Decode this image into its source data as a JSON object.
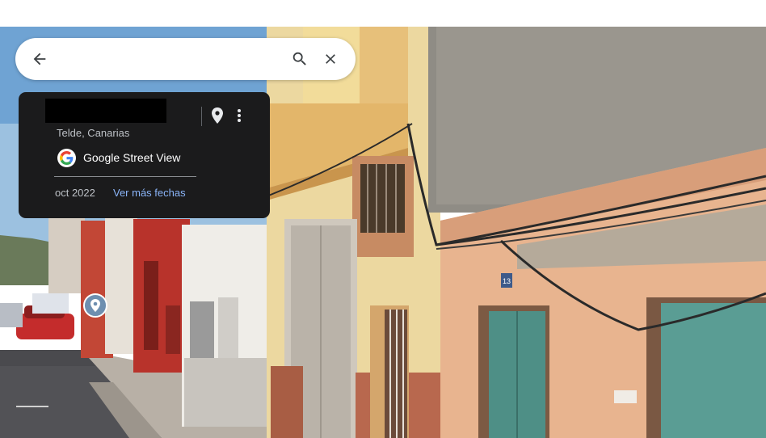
{
  "search": {
    "placeholder": "",
    "back_icon": "arrow-left-icon",
    "search_icon": "search-icon",
    "close_icon": "close-icon"
  },
  "info_card": {
    "title_redacted": true,
    "location": "Telde, Canarias",
    "brand": "Google Street View",
    "date": "oct 2022",
    "more_dates_link": "Ver más fechas",
    "pin_icon": "map-pin-icon",
    "more_icon": "more-vert-icon",
    "link_color": "#8ab4f8",
    "background_color": "#1b1b1c"
  },
  "street_view": {
    "scene": "street-view-panorama",
    "house_number": "13",
    "marker_icon": "location-marker-icon"
  }
}
